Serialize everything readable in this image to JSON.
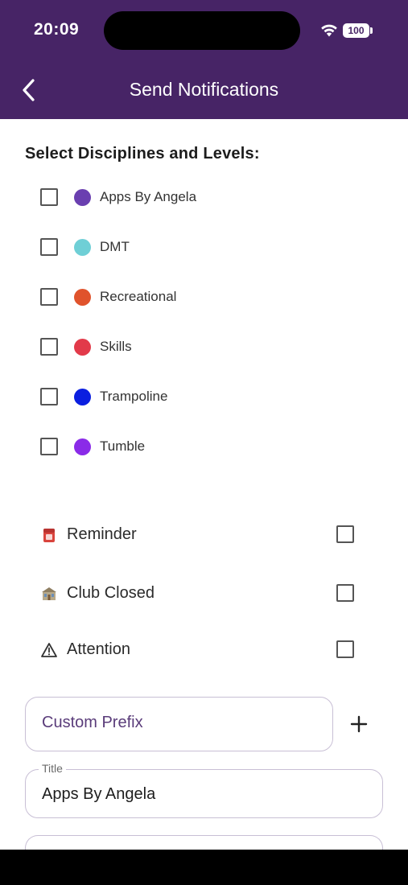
{
  "status_bar": {
    "time": "20:09",
    "battery": "100",
    "wifi_icon": "wifi-icon"
  },
  "app_bar": {
    "title": "Send Notifications",
    "back_icon": "back-arrow-icon",
    "background": "#472466"
  },
  "disciplines": {
    "heading": "Select Disciplines and Levels:",
    "items": [
      {
        "label": "Apps By Angela",
        "color": "#6a3fb0",
        "checked": false
      },
      {
        "label": "DMT",
        "color": "#6fcfd6",
        "checked": false
      },
      {
        "label": "Recreational",
        "color": "#e0532c",
        "checked": false
      },
      {
        "label": "Skills",
        "color": "#e23a4a",
        "checked": false
      },
      {
        "label": "Trampoline",
        "color": "#0b1fe0",
        "checked": false
      },
      {
        "label": "Tumble",
        "color": "#8a2be8",
        "checked": false
      }
    ]
  },
  "notification_types": [
    {
      "label": "Reminder",
      "icon": "reminder-icon",
      "checked": false
    },
    {
      "label": "Club Closed",
      "icon": "club-closed-icon",
      "checked": false
    },
    {
      "label": "Attention",
      "icon": "warning-icon",
      "checked": false
    }
  ],
  "custom_prefix": {
    "placeholder": "Custom Prefix",
    "add_icon": "plus-icon"
  },
  "title_field": {
    "label": "Title",
    "value": "Apps By Angela"
  }
}
